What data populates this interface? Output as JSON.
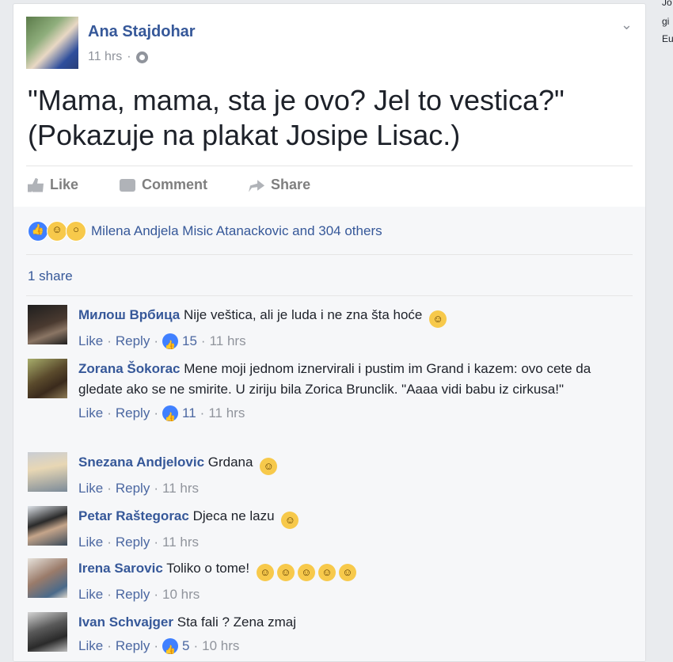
{
  "sidebar_right": {
    "lines": [
      "Jo",
      "gi",
      "Eu"
    ]
  },
  "post": {
    "author": "Ana Stajdohar",
    "time": "11 hrs",
    "dot": "·",
    "lines": [
      "\"Mama, mama, sta je ovo? Jel to vestica?\"",
      "(Pokazuje na plakat Josipe Lisac.)"
    ]
  },
  "actions": {
    "like": "Like",
    "comment": "Comment",
    "share": "Share"
  },
  "reactions": {
    "summary": "Milena Andjela Misic Atanackovic and 304 others"
  },
  "shares": {
    "label": "1 share"
  },
  "comments": [
    {
      "name": "Милош Врбица",
      "text": "Nije veštica, ali je luda i ne zna šta hoće",
      "emoji": "smile",
      "like": "Like",
      "reply": "Reply",
      "likes": "15",
      "time": "11 hrs"
    },
    {
      "name": "Zorana Šokorac",
      "text": "Mene moji jednom iznervirali i pustim im Grand i kazem: ovo cete da gledate ako se ne smirite. U ziriju bila Zorica Brunclik. \"Aaaa vidi babu iz cirkusa!\"",
      "like": "Like",
      "reply": "Reply",
      "likes": "11",
      "time": "11 hrs"
    },
    {
      "name": "Snezana Andjelovic",
      "text": "Grdana",
      "emoji": "smile",
      "like": "Like",
      "reply": "Reply",
      "time": "11 hrs"
    },
    {
      "name": "Petar Raštegorac",
      "text": "Djeca ne lazu",
      "emoji": "smile",
      "like": "Like",
      "reply": "Reply",
      "time": "11 hrs"
    },
    {
      "name": "Irena Sarovic",
      "text": "Toliko o tome!",
      "emoji": "laugh-x5",
      "like": "Like",
      "reply": "Reply",
      "time": "10 hrs"
    },
    {
      "name": "Ivan Schvajger",
      "text": "Sta fali ? Zena zmaj",
      "like": "Like",
      "reply": "Reply",
      "likes": "5",
      "time": "10 hrs"
    }
  ],
  "colors": {
    "link": "#365899",
    "meta": "#90949c",
    "like_blue": "#4080ff",
    "emoji": "#f7c94b"
  }
}
